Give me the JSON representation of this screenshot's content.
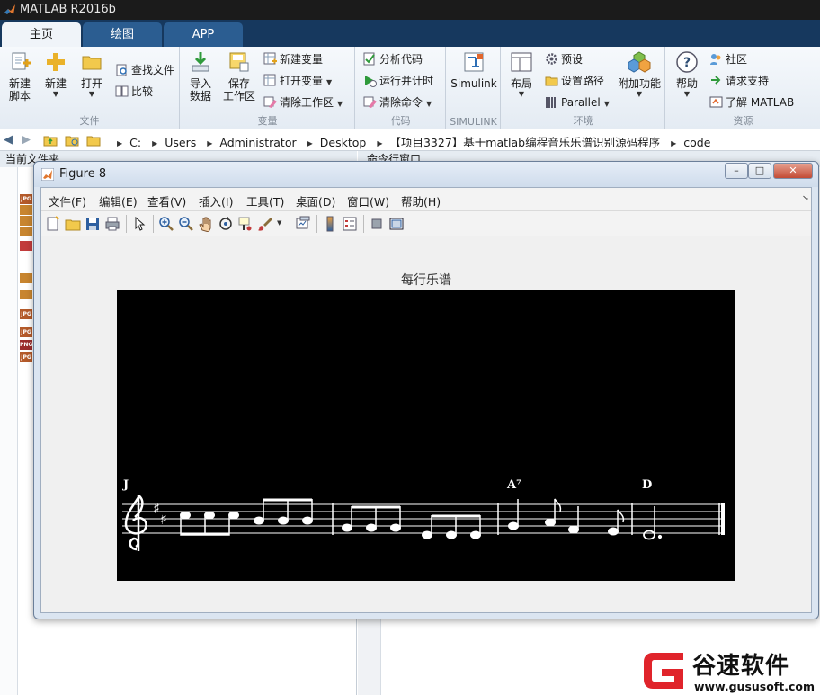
{
  "app": {
    "title": "MATLAB R2016b"
  },
  "tabs": [
    "主页",
    "绘图",
    "APP"
  ],
  "ribbon": {
    "file": {
      "label": "文件",
      "new_script": "新建\n脚本",
      "new": "新建",
      "open": "打开",
      "find_files": "查找文件",
      "compare": "比较"
    },
    "variable": {
      "label": "变量",
      "import": "导入\n数据",
      "save_ws": "保存\n工作区",
      "new_var": "新建变量",
      "open_var": "打开变量",
      "clear_ws": "清除工作区"
    },
    "code": {
      "label": "代码",
      "analyze": "分析代码",
      "run_time": "运行并计时",
      "clear_cmd": "清除命令"
    },
    "simulink": {
      "label": "SIMULINK",
      "simulink": "Simulink"
    },
    "env": {
      "label": "环境",
      "layout": "布局",
      "prefs": "预设",
      "set_path": "设置路径",
      "parallel": "Parallel",
      "addons": "附加功能"
    },
    "resources": {
      "label": "资源",
      "help": "帮助",
      "community": "社区",
      "support": "请求支持",
      "learn": "了解 MATLAB"
    }
  },
  "breadcrumb": [
    "C:",
    "Users",
    "Administrator",
    "Desktop",
    "【项目3327】基于matlab编程音乐乐谱识别源码程序",
    "code"
  ],
  "panels": {
    "current_folder": "当前文件夹",
    "command_window": "命令行窗口"
  },
  "file_icons": [
    "JPG",
    "JPG",
    "JPG",
    "JPG",
    "PNG",
    "JPG"
  ],
  "figure": {
    "title": "Figure 8",
    "menus": [
      "文件(F)",
      "编辑(E)",
      "查看(V)",
      "插入(I)",
      "工具(T)",
      "桌面(D)",
      "窗口(W)",
      "帮助(H)"
    ],
    "axes_title": "每行乐谱",
    "chord_labels": [
      "J",
      "A⁷",
      "D"
    ]
  },
  "watermark": {
    "brand": "谷速软件",
    "url": "www.gususoft.com"
  }
}
